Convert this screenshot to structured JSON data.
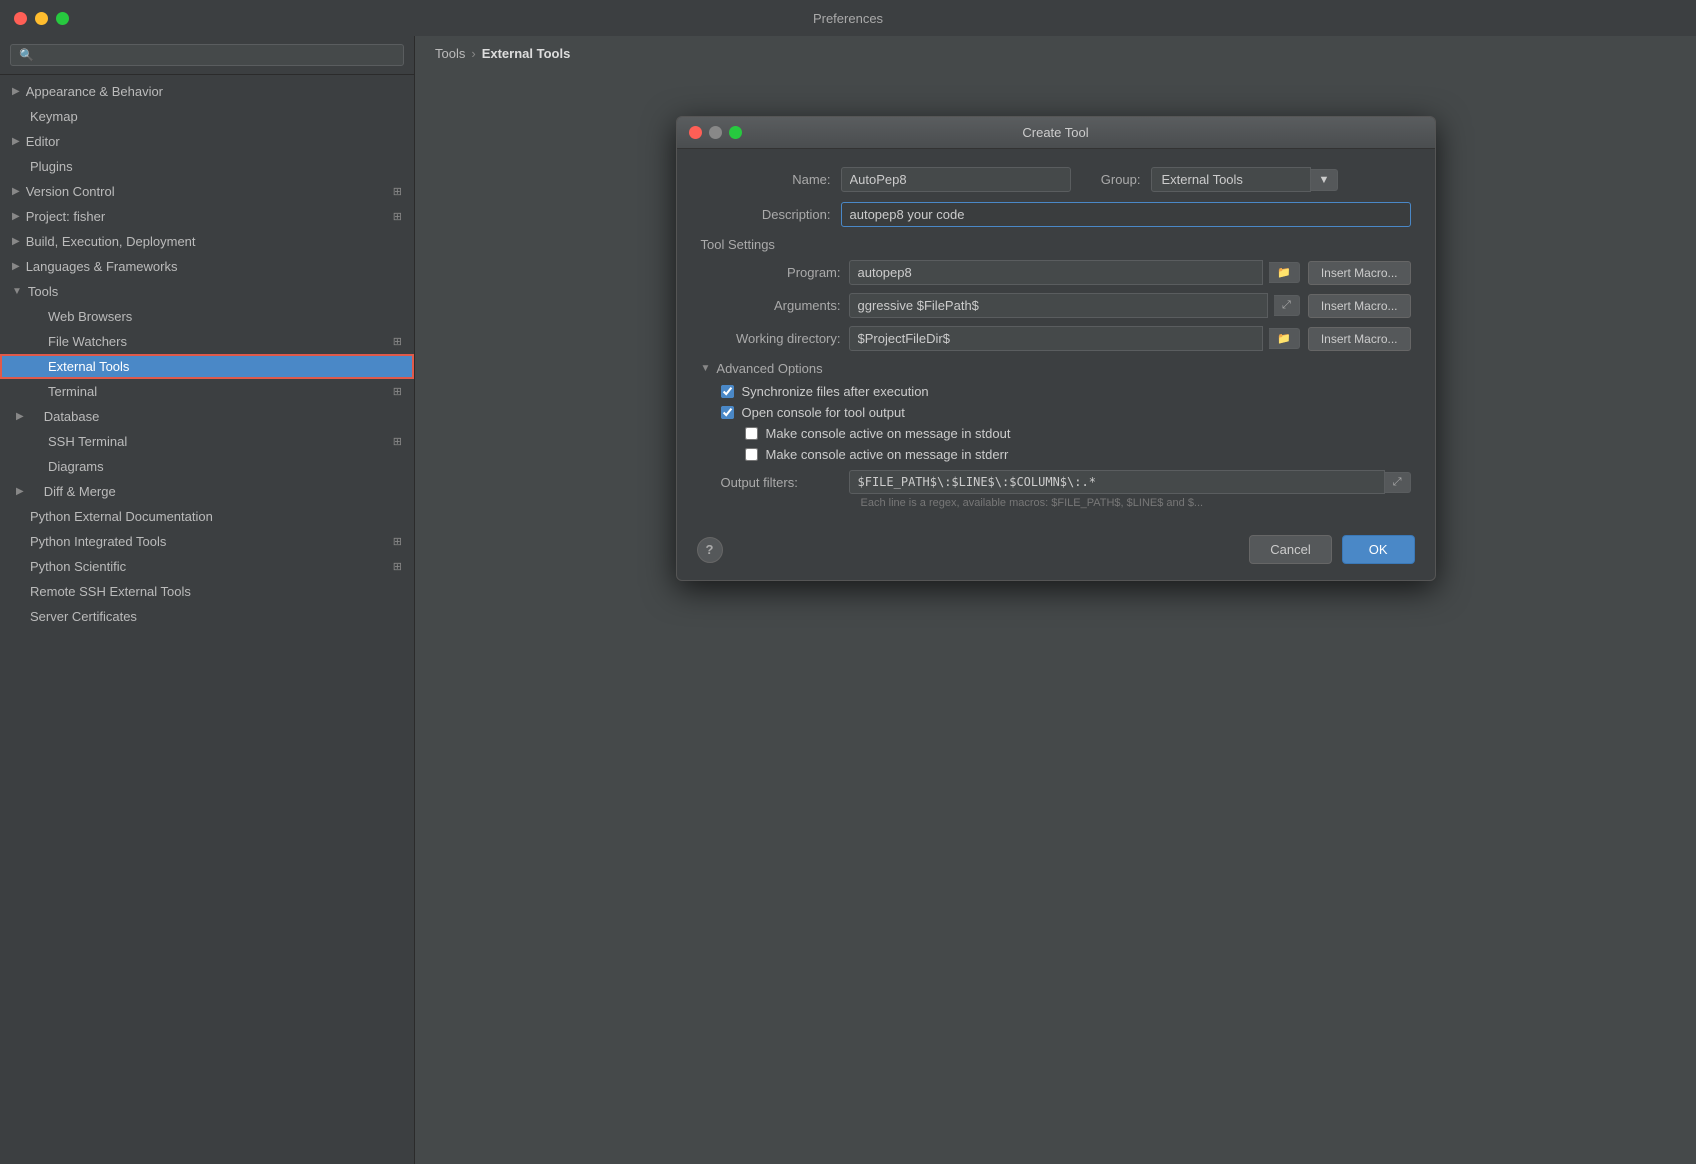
{
  "window": {
    "title": "Preferences"
  },
  "sidebar": {
    "search_placeholder": "🔍",
    "items": [
      {
        "id": "appearance",
        "label": "Appearance & Behavior",
        "level": 0,
        "has_arrow": true,
        "collapsed": true,
        "has_icon": false
      },
      {
        "id": "keymap",
        "label": "Keymap",
        "level": 0,
        "has_arrow": false
      },
      {
        "id": "editor",
        "label": "Editor",
        "level": 0,
        "has_arrow": true,
        "collapsed": true
      },
      {
        "id": "plugins",
        "label": "Plugins",
        "level": 0,
        "has_arrow": false
      },
      {
        "id": "version-control",
        "label": "Version Control",
        "level": 0,
        "has_arrow": true,
        "has_icon_right": true
      },
      {
        "id": "project-fisher",
        "label": "Project: fisher",
        "level": 0,
        "has_arrow": true,
        "has_icon_right": true
      },
      {
        "id": "build-exec-deploy",
        "label": "Build, Execution, Deployment",
        "level": 0,
        "has_arrow": true
      },
      {
        "id": "languages-frameworks",
        "label": "Languages & Frameworks",
        "level": 0,
        "has_arrow": true
      },
      {
        "id": "tools",
        "label": "Tools",
        "level": 0,
        "has_arrow": true,
        "expanded": true
      },
      {
        "id": "web-browsers",
        "label": "Web Browsers",
        "level": 1,
        "has_arrow": false
      },
      {
        "id": "file-watchers",
        "label": "File Watchers",
        "level": 1,
        "has_arrow": false,
        "has_icon_right": true
      },
      {
        "id": "external-tools",
        "label": "External Tools",
        "level": 1,
        "has_arrow": false,
        "selected": true
      },
      {
        "id": "terminal",
        "label": "Terminal",
        "level": 1,
        "has_arrow": false,
        "has_icon_right": true
      },
      {
        "id": "database",
        "label": "Database",
        "level": 1,
        "has_arrow": true
      },
      {
        "id": "ssh-terminal",
        "label": "SSH Terminal",
        "level": 1,
        "has_arrow": false,
        "has_icon_right": true
      },
      {
        "id": "diagrams",
        "label": "Diagrams",
        "level": 1,
        "has_arrow": false
      },
      {
        "id": "diff-merge",
        "label": "Diff & Merge",
        "level": 1,
        "has_arrow": true
      },
      {
        "id": "python-ext-docs",
        "label": "Python External Documentation",
        "level": 0,
        "has_arrow": false
      },
      {
        "id": "python-integrated",
        "label": "Python Integrated Tools",
        "level": 0,
        "has_arrow": false,
        "has_icon_right": true
      },
      {
        "id": "python-scientific",
        "label": "Python Scientific",
        "level": 0,
        "has_arrow": false,
        "has_icon_right": true
      },
      {
        "id": "remote-ssh",
        "label": "Remote SSH External Tools",
        "level": 0,
        "has_arrow": false
      },
      {
        "id": "server-certs",
        "label": "Server Certificates",
        "level": 0,
        "has_arrow": false
      }
    ]
  },
  "breadcrumb": {
    "tools": "Tools",
    "separator": "›",
    "current": "External Tools"
  },
  "dialog": {
    "title": "Create Tool",
    "name_label": "Name:",
    "name_value": "AutoPep8",
    "group_label": "Group:",
    "group_value": "External Tools",
    "description_label": "Description:",
    "description_value": "autopep8 your code",
    "tool_settings_label": "Tool Settings",
    "program_label": "Program:",
    "program_value": "autopep8",
    "arguments_label": "Arguments:",
    "arguments_value": "ggressive $FilePath$",
    "working_dir_label": "Working directory:",
    "working_dir_value": "$ProjectFileDir$",
    "insert_macro": "Insert Macro...",
    "advanced_label": "Advanced Options",
    "sync_files_label": "Synchronize files after execution",
    "sync_files_checked": true,
    "open_console_label": "Open console for tool output",
    "open_console_checked": true,
    "make_active_stdout_label": "Make console active on message in stdout",
    "make_active_stdout_checked": false,
    "make_active_stderr_label": "Make console active on message in stderr",
    "make_active_stderr_checked": false,
    "output_filters_label": "Output filters:",
    "output_filters_value": "$FILE_PATH$\\:$LINE$\\:$COLUMN$\\:.*",
    "regex_hint": "Each line is a regex, available macros: $FILE_PATH$, $LINE$ and $...",
    "cancel_label": "Cancel",
    "ok_label": "OK",
    "help_label": "?"
  }
}
